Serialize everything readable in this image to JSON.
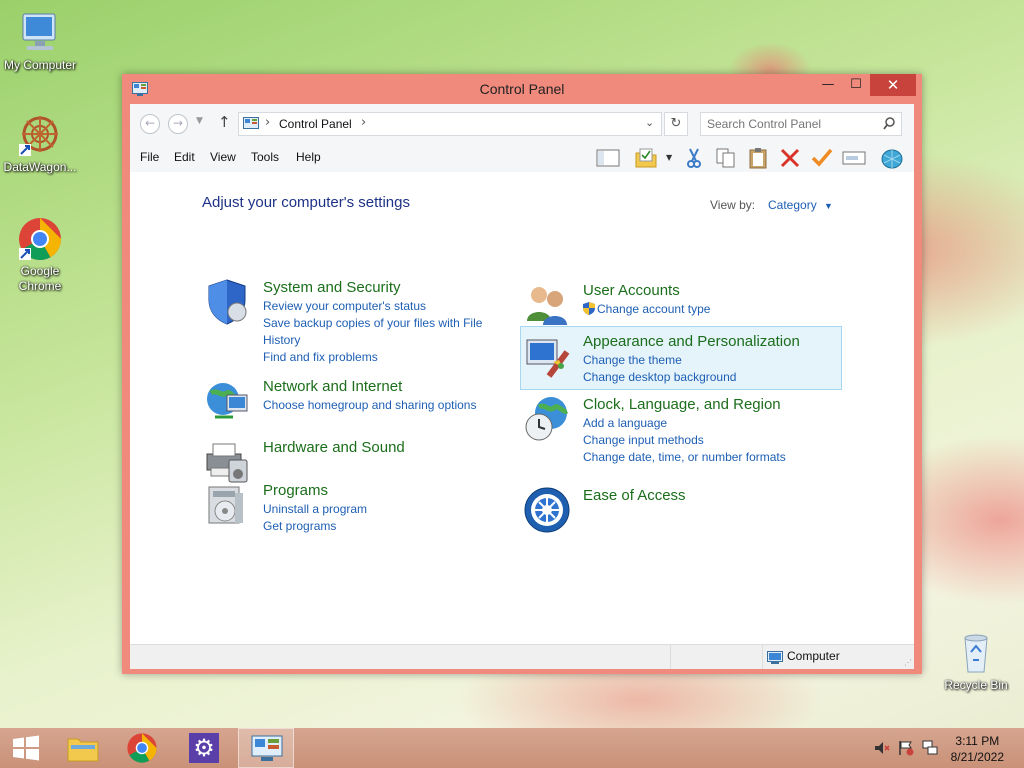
{
  "desktop": {
    "icons": [
      {
        "label": "My Computer"
      },
      {
        "label": "DataWagon..."
      },
      {
        "label": "Google Chrome"
      },
      {
        "label": "Recycle Bin"
      }
    ]
  },
  "window": {
    "title": "Control Panel",
    "controls": {
      "minimize": "—",
      "maximize": "☐",
      "close": "✕"
    },
    "address": {
      "breadcrumb": "Control Panel",
      "separator": "›"
    },
    "search": {
      "placeholder": "Search Control Panel"
    },
    "menu": [
      "File",
      "Edit",
      "View",
      "Tools",
      "Help"
    ],
    "heading": "Adjust your computer's settings",
    "view_by": {
      "label": "View by:",
      "value": "Category"
    },
    "categories_left": [
      {
        "title": "System and Security",
        "links": [
          "Review your computer's status",
          "Save backup copies of your files with File",
          "History",
          "Find and fix problems"
        ]
      },
      {
        "title": "Network and Internet",
        "links": [
          "Choose homegroup and sharing options"
        ]
      },
      {
        "title": "Hardware and Sound",
        "links": []
      },
      {
        "title": "Programs",
        "links": [
          "Uninstall a program",
          "Get programs"
        ]
      }
    ],
    "categories_right": [
      {
        "title": "User Accounts",
        "links": [
          "Change account type"
        ]
      },
      {
        "title": "Appearance and Personalization",
        "links": [
          "Change the theme",
          "Change desktop background"
        ]
      },
      {
        "title": "Clock, Language, and Region",
        "links": [
          "Add a language",
          "Change input methods",
          "Change date, time, or number formats"
        ]
      },
      {
        "title": "Ease of Access",
        "links": []
      }
    ],
    "status": "Computer"
  },
  "taskbar": {
    "clock": {
      "time": "3:11 PM",
      "date": "8/21/2022"
    }
  },
  "colors": {
    "window_border": "#f08a7c",
    "link": "#1e5fb4",
    "category": "#1b6e1b",
    "heading": "#1e3287"
  }
}
